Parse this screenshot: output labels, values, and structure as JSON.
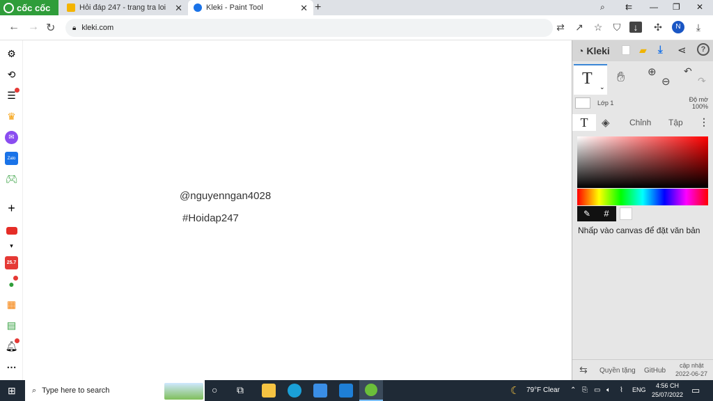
{
  "browser": {
    "brand": "cốc cốc",
    "tabs": [
      {
        "title": "Hỏi đáp 247 - trang tra loi",
        "active": false
      },
      {
        "title": "Kleki - Paint Tool",
        "active": true
      }
    ],
    "url": "kleki.com",
    "profile_initial": "N",
    "icons": [
      "back-icon",
      "forward-icon",
      "reload-icon",
      "lock-icon",
      "translate-icon",
      "share-icon",
      "star-icon",
      "shield-icon",
      "download-icon",
      "extensions-icon",
      "downloads-icon"
    ]
  },
  "sidebar": {
    "items": [
      "gear-icon",
      "history-icon",
      "list-icon",
      "crown-icon",
      "messenger-icon",
      "zalo-icon",
      "gamepad-icon",
      "plus-icon",
      "youtube-icon",
      "chevron-down-icon",
      "shopee-icon",
      "turtle-icon",
      "cart-icon",
      "sheet-icon",
      "bell-icon",
      "more-icon"
    ],
    "zalo_label": "Zalo",
    "shopee_label": "25.7"
  },
  "canvas": {
    "lines": [
      "@nguyenngan4028",
      "#Hoidap247"
    ]
  },
  "kleki": {
    "logo": "Kleki",
    "layer_name": "Lớp 1",
    "opacity_label": "Độ mờ",
    "opacity_value": "100%",
    "tabs": [
      "T",
      "Chỉnh",
      "Tập"
    ],
    "hash_symbol": "#",
    "hint": "Nhấp vào canvas để đặt văn bản",
    "footer": {
      "quyen": "Quyền tặng",
      "github": "GitHub",
      "update_label": "cập nhật",
      "update_date": "2022-06-27"
    }
  },
  "taskbar": {
    "search_placeholder": "Type here to search",
    "weather": "79°F  Clear",
    "lang": "ENG",
    "time": "4:56 CH",
    "date": "25/07/2022"
  },
  "colors": {
    "brand_green": "#2f9d3a",
    "accent_blue": "#3a86d6",
    "taskbar": "#1f2a36"
  }
}
